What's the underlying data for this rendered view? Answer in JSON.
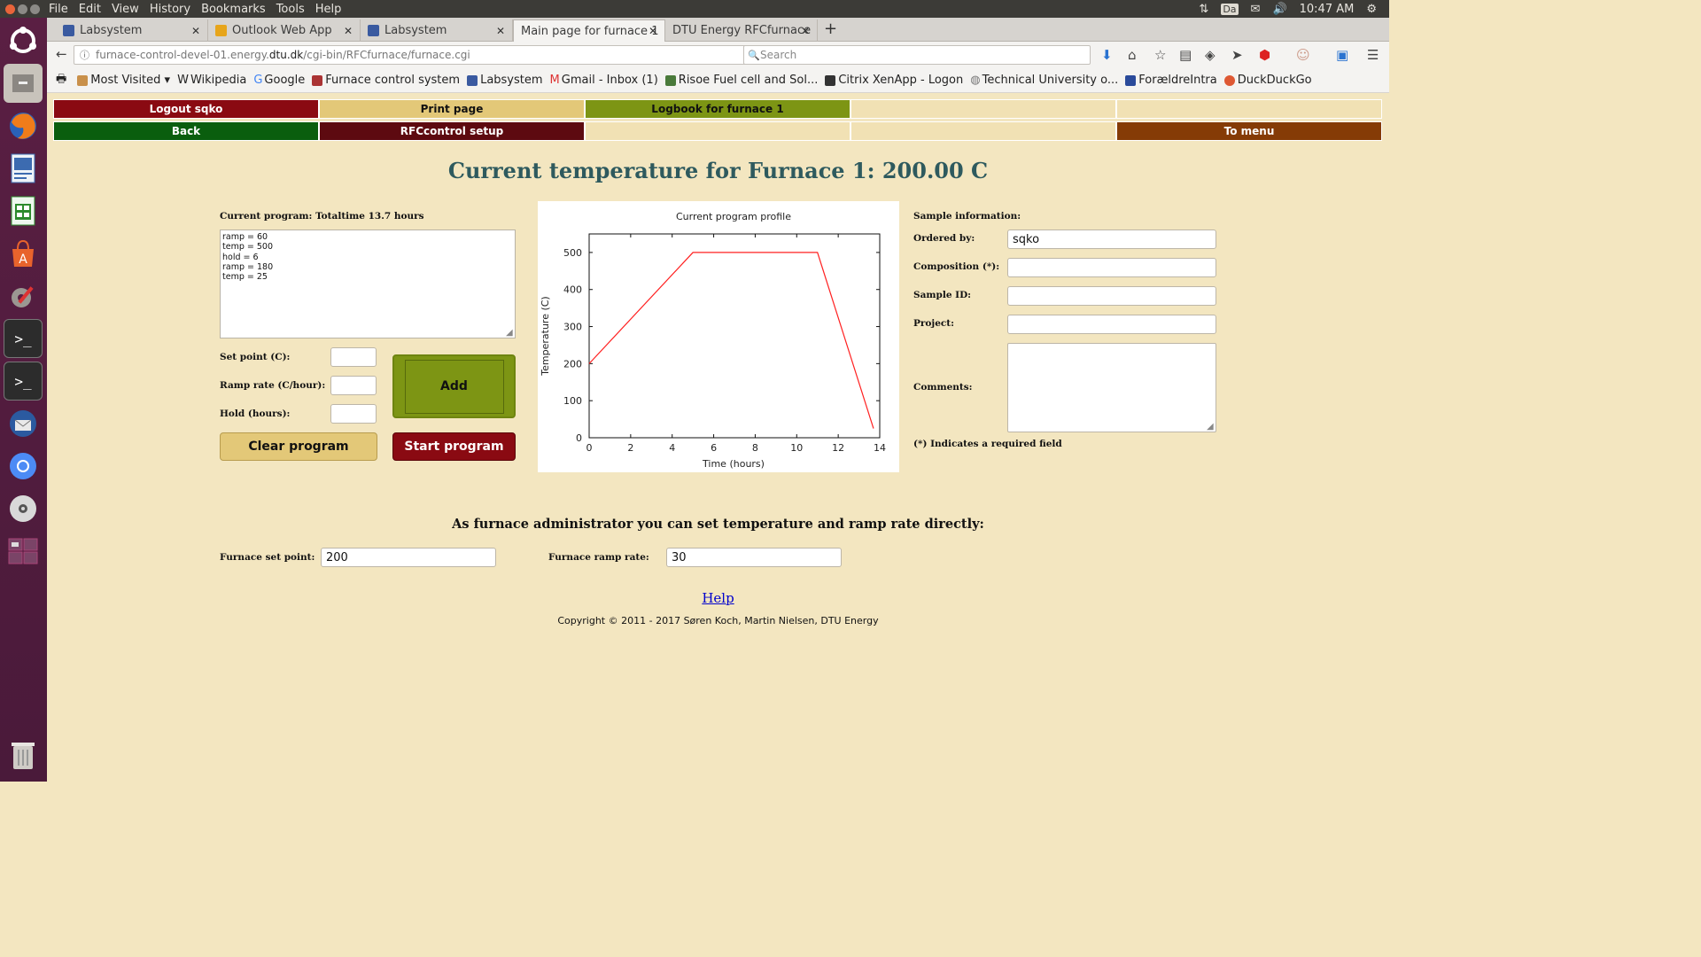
{
  "system_menu": [
    "File",
    "Edit",
    "View",
    "History",
    "Bookmarks",
    "Tools",
    "Help"
  ],
  "system_tray": {
    "keyboard": "Da",
    "clock": "10:47 AM"
  },
  "tabs": [
    {
      "label": "Labsystem"
    },
    {
      "label": "Outlook Web App"
    },
    {
      "label": "Labsystem"
    },
    {
      "label": "Main page for furnace 1"
    },
    {
      "label": "DTU Energy RFCfurnace"
    }
  ],
  "address": {
    "pre": "furnace-control-devel-01.energy.",
    "domain": "dtu.dk",
    "post": "/cgi-bin/RFCfurnace/furnace.cgi"
  },
  "search": {
    "placeholder": "Search"
  },
  "bookmarks": [
    "Most Visited",
    "Wikipedia",
    "Google",
    "Furnace control system",
    "Labsystem",
    "Gmail - Inbox (1)",
    "Risoe Fuel cell and Sol...",
    "Citrix XenApp - Logon",
    "Technical University o...",
    "ForældreIntra",
    "DuckDuckGo"
  ],
  "nav": {
    "row1": [
      "Logout sqko",
      "Print page",
      "Logbook for furnace 1",
      "",
      ""
    ],
    "row2": [
      "Back",
      "RFCcontrol setup",
      "",
      "",
      "To menu"
    ]
  },
  "colors": {
    "darkred": "#8a0a12",
    "gold": "#e3c878",
    "olive": "#7d9514",
    "darkgreen": "#0a5e0e",
    "maroon": "#5d0a10",
    "brown": "#853b06",
    "pale": "#f1e1b4"
  },
  "title": "Current temperature for Furnace 1: 200.00 C",
  "program": {
    "heading": "Current program: Totaltime 13.7 hours",
    "text": "ramp = 60\ntemp = 500\nhold = 6\nramp = 180\ntemp = 25",
    "set_point_label": "Set point (C):",
    "ramp_rate_label": "Ramp rate (C/hour):",
    "hold_label": "Hold (hours):",
    "add_label": "Add",
    "clear_label": "Clear program",
    "start_label": "Start program"
  },
  "chart_data": {
    "type": "line",
    "title": "Current program profile",
    "xlabel": "Time (hours)",
    "ylabel": "Temperature (C)",
    "xlim": [
      0,
      14
    ],
    "ylim": [
      0,
      550
    ],
    "xticks": [
      0,
      2,
      4,
      6,
      8,
      10,
      12,
      14
    ],
    "yticks": [
      0,
      100,
      200,
      300,
      400,
      500
    ],
    "series": [
      {
        "x": [
          0,
          5,
          11,
          13.7
        ],
        "y": [
          200,
          500,
          500,
          25
        ],
        "color": "#ff2020"
      }
    ]
  },
  "sample": {
    "heading": "Sample information:",
    "ordered_by_label": "Ordered by:",
    "ordered_by_value": "sqko",
    "composition_label": "Composition (*):",
    "sample_id_label": "Sample ID:",
    "project_label": "Project:",
    "comments_label": "Comments:",
    "required_note": "(*) Indicates a required field"
  },
  "admin": {
    "heading": "As furnace administrator you can set temperature and ramp rate directly:",
    "setpoint_label": "Furnace set point:",
    "setpoint_value": "200",
    "ramprate_label": "Furnace ramp rate:",
    "ramprate_value": "30"
  },
  "footer": {
    "help": "Help",
    "copyright": "Copyright © 2011 - 2017 Søren Koch, Martin Nielsen, DTU Energy"
  }
}
